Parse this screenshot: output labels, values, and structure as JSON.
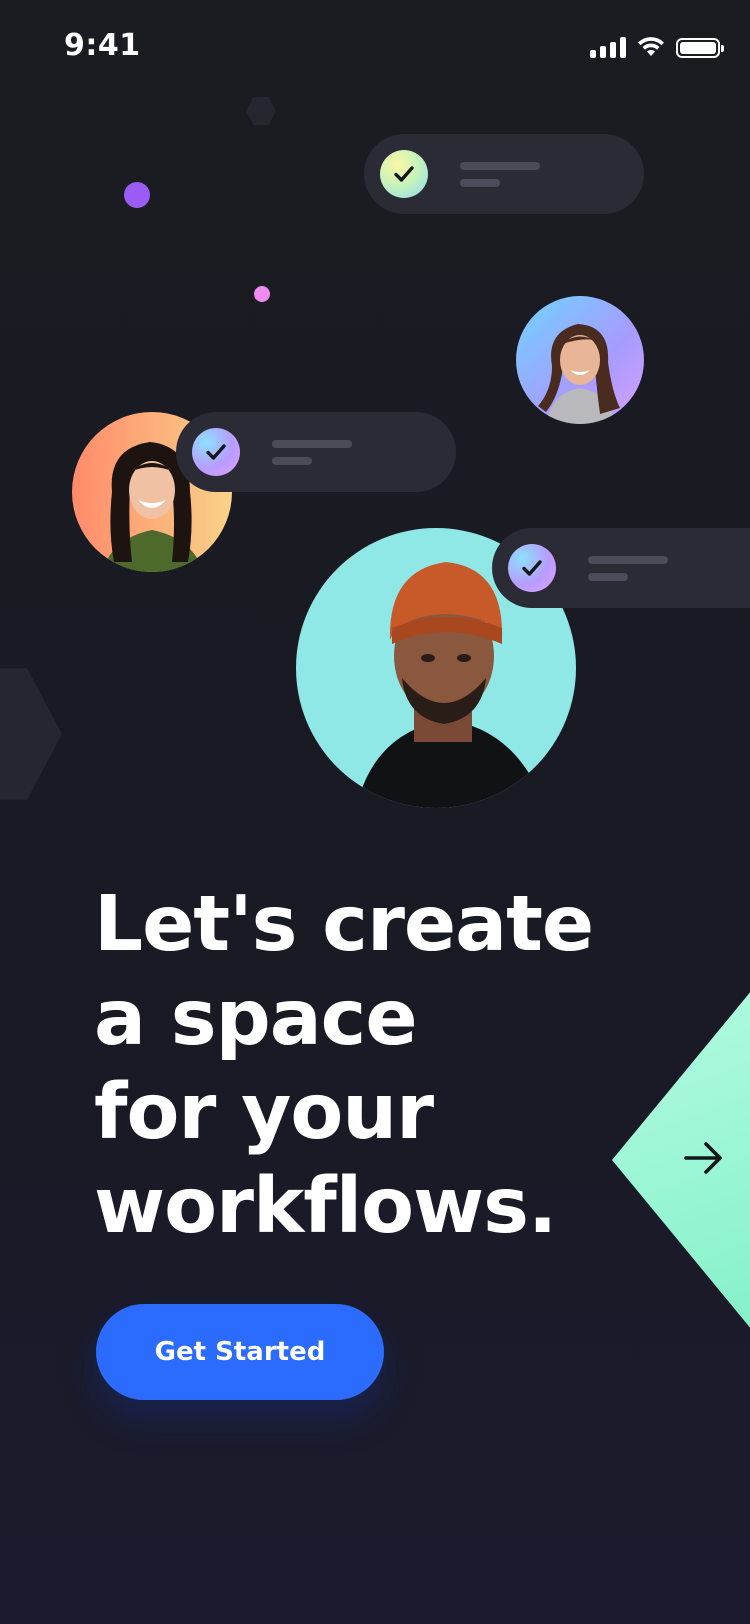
{
  "status_bar": {
    "time": "9:41",
    "icons": [
      "signal-icon",
      "wifi-icon",
      "battery-icon"
    ]
  },
  "hero": {
    "headline_lines": [
      "Let's create",
      "a space",
      "for your",
      "workflows."
    ]
  },
  "cta": {
    "label": "Get Started"
  },
  "next": {
    "icon": "arrow-right-icon"
  },
  "colors": {
    "background": "#1b1b23",
    "accent_blue": "#2b6cff",
    "mint": "#8ff3cc",
    "pill": "#2a2b34",
    "dot_purple": "#9a5cf5",
    "dot_pink": "#f08cf0"
  }
}
